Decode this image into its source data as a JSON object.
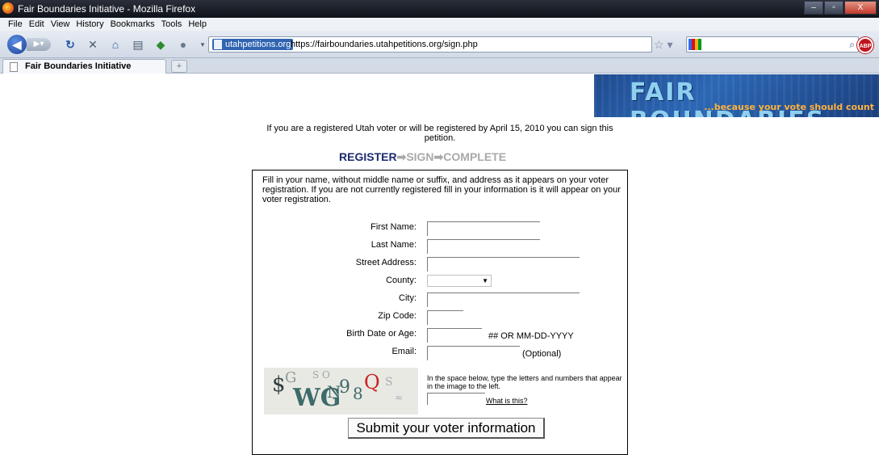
{
  "window": {
    "title": "Fair Boundaries Initiative - Mozilla Firefox",
    "minimize": "–",
    "maximize": "▫",
    "close": "X"
  },
  "menu": [
    "File",
    "Edit",
    "View",
    "History",
    "Bookmarks",
    "Tools",
    "Help"
  ],
  "toolbar": {
    "site_badge": "utahpetitions.org",
    "url": "https://fairboundaries.utahpetitions.org/sign.php",
    "search_value": ""
  },
  "tab": {
    "title": "Fair Boundaries Initiative",
    "new_tab": "+"
  },
  "banner": {
    "title": "FAIR BOUNDARIES",
    "tagline": "...because your vote should count"
  },
  "intro": "If you are a registered Utah voter or will be registered by April 15, 2010 you can sign this petition.",
  "steps": {
    "register": "REGISTER",
    "arrow": "➡",
    "sign": "SIGN",
    "complete": "COMPLETE"
  },
  "form": {
    "instructions": "Fill in your name, without middle name or suffix, and address as it appears on your voter registration. If you are not currently registered fill in your information is it will appear on your voter registration.",
    "first_name_label": "First Name:",
    "last_name_label": "Last Name:",
    "street_label": "Street Address:",
    "county_label": "County:",
    "county_value": "",
    "city_label": "City:",
    "zip_label": "Zip Code:",
    "birth_label": "Birth Date or Age:",
    "birth_hint": "## OR MM-DD-YYYY",
    "email_label": "Email:",
    "email_hint": "(Optional)",
    "captcha_instructions": "In the space below, type the letters and numbers that appear in the image to the left.",
    "captcha_link": "What is this?",
    "submit": "Submit your voter information"
  }
}
